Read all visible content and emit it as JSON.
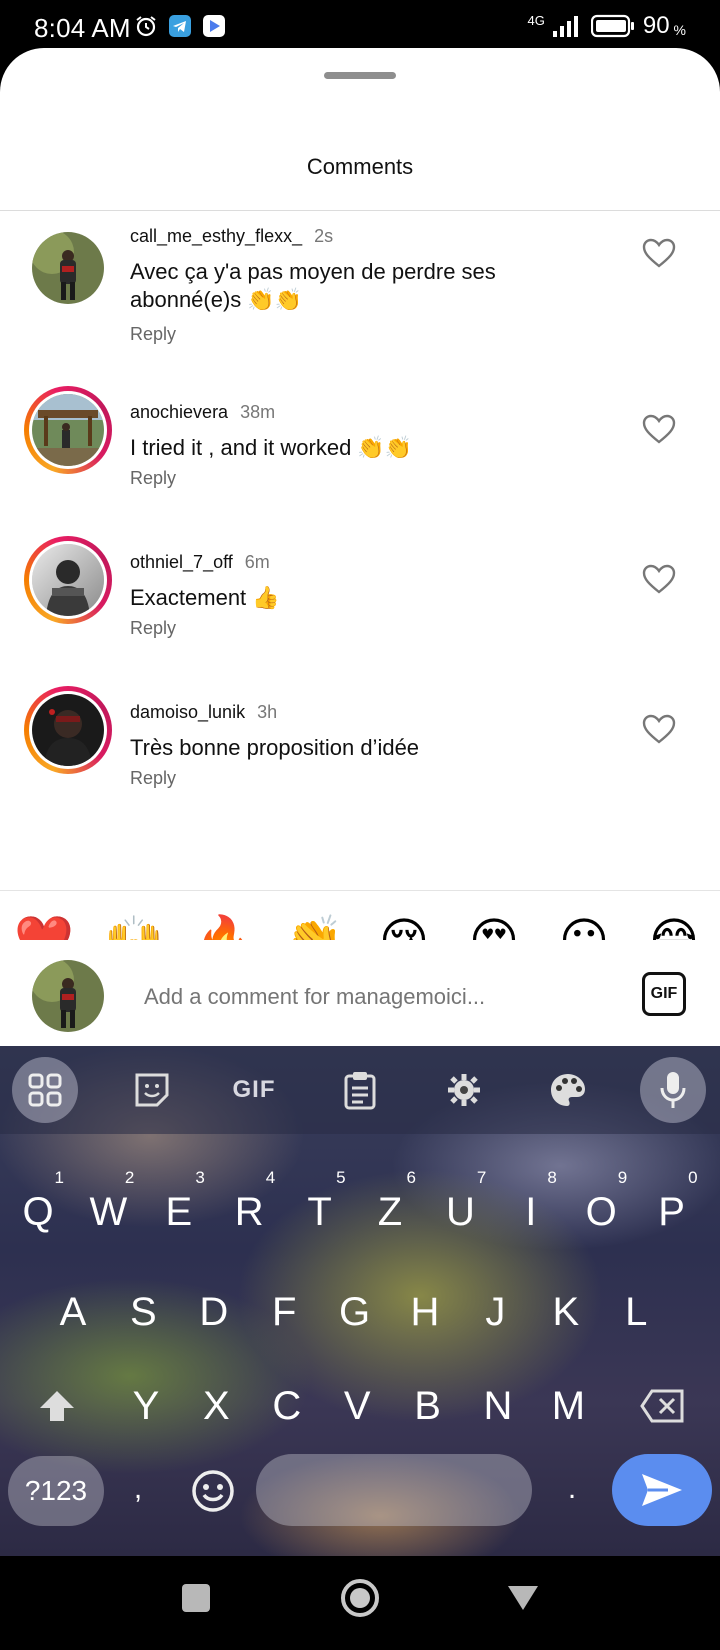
{
  "status_bar": {
    "time": "8:04 AM",
    "network": "4G",
    "battery": "90",
    "battery_unit": "%"
  },
  "sheet": {
    "title": "Comments"
  },
  "comments": [
    {
      "username": "call_me_esthy_flexx_",
      "time": "2s",
      "text_line1": "Avec ça y'a pas moyen de perdre ses",
      "text_line2": "abonné(e)s 👏👏",
      "reply": "Reply",
      "story_ring": false
    },
    {
      "username": "anochievera",
      "time": "38m",
      "text_line1": "I tried it , and it worked 👏👏",
      "text_line2": "",
      "reply": "Reply",
      "story_ring": true
    },
    {
      "username": "othniel_7_off",
      "time": "6m",
      "text_line1": "Exactement 👍",
      "text_line2": "",
      "reply": "Reply",
      "story_ring": true
    },
    {
      "username": "damoiso_lunik",
      "time": "3h",
      "text_line1": "Très bonne proposition d’idée",
      "text_line2": "",
      "reply": "Reply",
      "story_ring": true
    }
  ],
  "reactions": [
    "❤️",
    "🙌",
    "🔥",
    "👏",
    "😢",
    "😍",
    "😮",
    "😂"
  ],
  "comment_input": {
    "placeholder": "Add a comment for managemoici...",
    "gif_label": "GIF"
  },
  "keyboard": {
    "toolbar_gif": "GIF",
    "row1": [
      {
        "k": "Q",
        "n": "1"
      },
      {
        "k": "W",
        "n": "2"
      },
      {
        "k": "E",
        "n": "3"
      },
      {
        "k": "R",
        "n": "4"
      },
      {
        "k": "T",
        "n": "5"
      },
      {
        "k": "Z",
        "n": "6"
      },
      {
        "k": "U",
        "n": "7"
      },
      {
        "k": "I",
        "n": "8"
      },
      {
        "k": "O",
        "n": "9"
      },
      {
        "k": "P",
        "n": "0"
      }
    ],
    "row2": [
      "A",
      "S",
      "D",
      "F",
      "G",
      "H",
      "J",
      "K",
      "L"
    ],
    "row3": [
      "Y",
      "X",
      "C",
      "V",
      "B",
      "N",
      "M"
    ],
    "symbols_key": "?123",
    "comma_key": ",",
    "period_key": "."
  },
  "colors": {
    "send_button": "#5b8def",
    "ring_start": "#f9a825",
    "ring_end": "#c2185b"
  }
}
